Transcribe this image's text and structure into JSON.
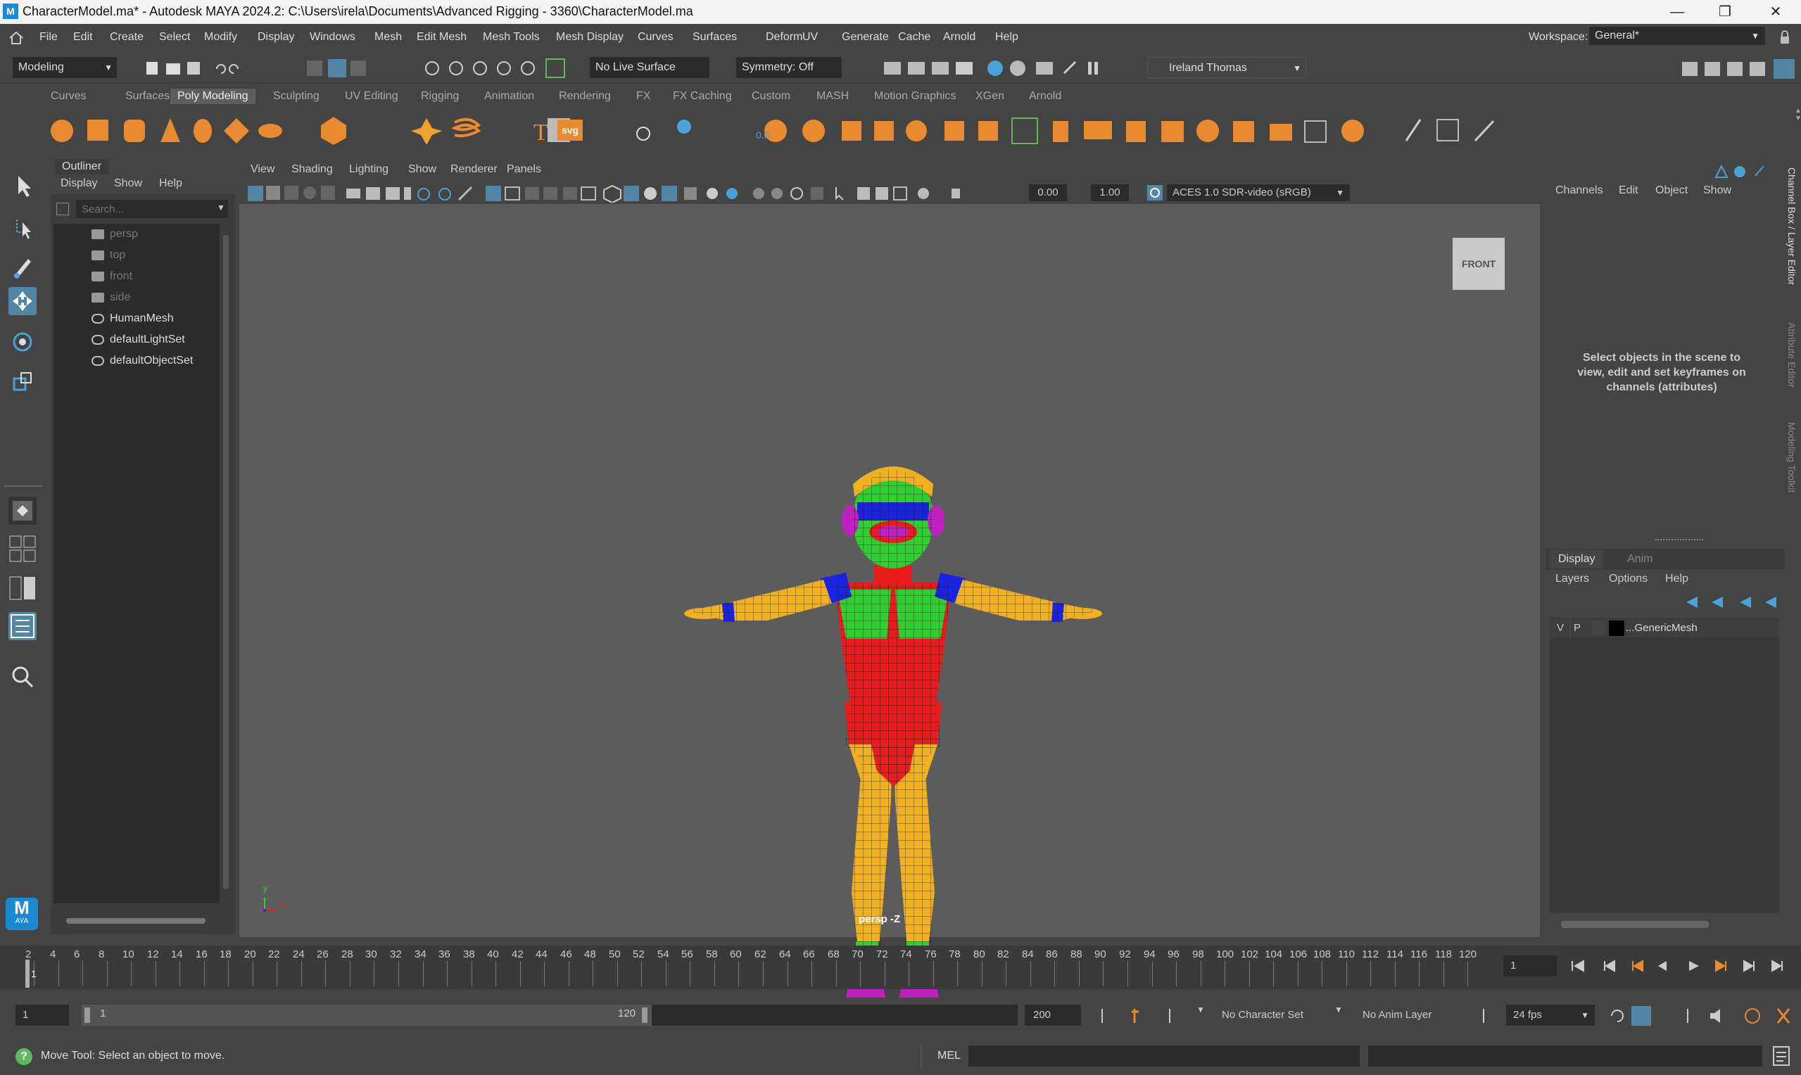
{
  "window": {
    "app_icon": "M",
    "title": "CharacterModel.ma* - Autodesk MAYA 2024.2: C:\\Users\\irela\\Documents\\Advanced Rigging - 3360\\CharacterModel.ma",
    "minimize": "—",
    "maximize": "❐",
    "close": "✕"
  },
  "menu": [
    "File",
    "Edit",
    "Create",
    "Select",
    "Modify",
    "Display",
    "Windows",
    "Mesh",
    "Edit Mesh",
    "Mesh Tools",
    "Mesh Display",
    "Curves",
    "Surfaces",
    "Deform",
    "UV",
    "Generate",
    "Cache",
    "Arnold",
    "Help"
  ],
  "workspace": {
    "label": "Workspace:",
    "value": "General*"
  },
  "statusline": {
    "mode": "Modeling",
    "live_surface": "No Live Surface",
    "symmetry": "Symmetry: Off",
    "user": "Ireland Thomas"
  },
  "shelf_tabs": [
    "Curves",
    "Surfaces",
    "Poly Modeling",
    "Sculpting",
    "UV Editing",
    "Rigging",
    "Animation",
    "Rendering",
    "FX",
    "FX Caching",
    "Custom",
    "MASH",
    "Motion Graphics",
    "XGen",
    "Arnold"
  ],
  "shelf_active": "Poly Modeling",
  "shelf_svg_label": "svg",
  "shelf_text_label": "T",
  "shelf_value_label": "0.0",
  "outliner": {
    "tab": "Outliner",
    "menu": [
      "Display",
      "Show",
      "Help"
    ],
    "search_placeholder": "Search...",
    "items": [
      {
        "name": "persp",
        "dim": true
      },
      {
        "name": "top",
        "dim": true
      },
      {
        "name": "front",
        "dim": true
      },
      {
        "name": "side",
        "dim": true
      },
      {
        "name": "HumanMesh",
        "dim": false
      },
      {
        "name": "defaultLightSet",
        "dim": false
      },
      {
        "name": "defaultObjectSet",
        "dim": false
      }
    ]
  },
  "viewport": {
    "menu": [
      "View",
      "Shading",
      "Lighting",
      "Show",
      "Renderer",
      "Panels"
    ],
    "exposure": "0.00",
    "gamma": "1.00",
    "color_space": "ACES 1.0 SDR-video (sRGB)",
    "view_cube": "FRONT",
    "camera_label": "persp -Z",
    "axis_y": "y",
    "axis_x": "x"
  },
  "channel_box": {
    "menu": [
      "Channels",
      "Edit",
      "Object",
      "Show"
    ],
    "message": "Select objects in the scene to view, edit and set keyframes on channels (attributes)",
    "side_tabs": [
      "Channel Box / Layer Editor",
      "Attribute Editor",
      "Modeling Toolkit"
    ]
  },
  "layer_editor": {
    "tabs": [
      "Display",
      "Anim"
    ],
    "active_tab": "Display",
    "menu": [
      "Layers",
      "Options",
      "Help"
    ],
    "layer": {
      "v": "V",
      "p": "P",
      "name": "...GenericMesh"
    }
  },
  "timeline": {
    "ticks": [
      "2",
      "4",
      "6",
      "8",
      "10",
      "12",
      "14",
      "16",
      "18",
      "20",
      "22",
      "24",
      "26",
      "28",
      "30",
      "32",
      "34",
      "36",
      "38",
      "40",
      "42",
      "44",
      "46",
      "48",
      "50",
      "52",
      "54",
      "56",
      "58",
      "60",
      "62",
      "64",
      "66",
      "68",
      "70",
      "72",
      "74",
      "76",
      "78",
      "80",
      "82",
      "84",
      "86",
      "88",
      "90",
      "92",
      "94",
      "96",
      "98",
      "100",
      "102",
      "104",
      "106",
      "108",
      "110",
      "112",
      "114",
      "116",
      "118",
      "120"
    ],
    "current_marker": "1",
    "current_frame": "1"
  },
  "range": {
    "start": "1",
    "range_start": "1",
    "range_end": "120",
    "end": "200",
    "character_set": "No Character Set",
    "anim_layer": "No Anim Layer",
    "fps": "24 fps"
  },
  "help_line": {
    "text": "Move Tool: Select an object to move.",
    "mel_label": "MEL"
  },
  "maya_logo": {
    "letter": "M",
    "sub": "AYA"
  },
  "colors": {
    "accent": "#5285a6",
    "red": "#e81c1c",
    "green": "#2fcf2f",
    "yellow": "#f0b020",
    "blue": "#1a23e0",
    "magenta": "#c020c0"
  }
}
